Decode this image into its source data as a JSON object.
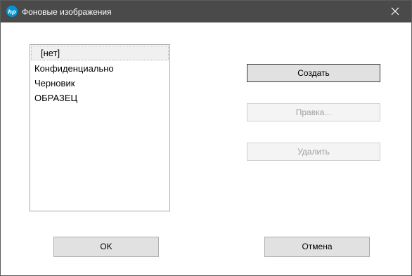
{
  "window": {
    "title": "Фоновые изображения",
    "app_icon": "hp-logo-icon",
    "app_icon_label": "hp",
    "close_icon": "close-icon",
    "titlebar_color": "#4a4a4a",
    "accent_color": "#0096d6"
  },
  "list": {
    "items": [
      {
        "label": "[нет]",
        "selected": true
      },
      {
        "label": "Конфиденциально",
        "selected": false
      },
      {
        "label": "Черновик",
        "selected": false
      },
      {
        "label": "ОБРАЗЕЦ",
        "selected": false
      }
    ]
  },
  "actions": {
    "create_label": "Создать",
    "edit_label": "Правка...",
    "delete_label": "Удалить",
    "edit_enabled": false,
    "delete_enabled": false
  },
  "footer": {
    "ok_label": "OK",
    "cancel_label": "Отмена"
  }
}
